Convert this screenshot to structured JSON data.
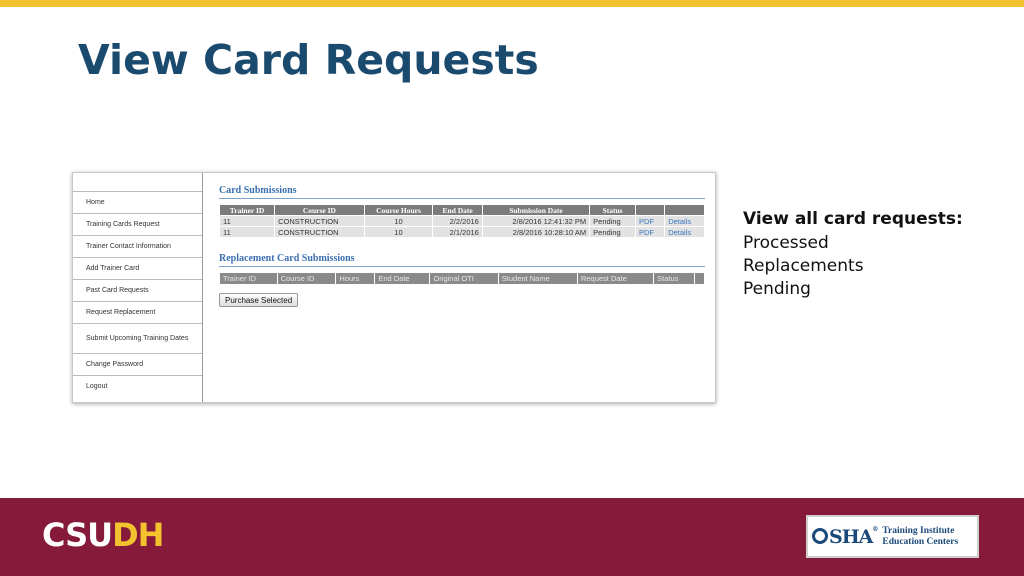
{
  "slide": {
    "title": "View Card Requests",
    "side_heading": "View all card requests:",
    "side_items": [
      "Processed",
      "Replacements",
      "Pending"
    ],
    "colors": {
      "title": "#1b4a6f",
      "top_bar": "#f3c22f",
      "footer": "#861a3a"
    }
  },
  "sidebar": {
    "items": [
      {
        "label": "Home"
      },
      {
        "label": "Training Cards Request"
      },
      {
        "label": "Trainer Contact Information"
      },
      {
        "label": "Add Trainer Card"
      },
      {
        "label": "Past Card Requests"
      },
      {
        "label": "Request Replacement"
      },
      {
        "label": "Submit Upcoming Training Dates"
      },
      {
        "label": "Change Password"
      },
      {
        "label": "Logout"
      }
    ]
  },
  "card_submissions": {
    "title": "Card Submissions",
    "headers": [
      "Trainer ID",
      "Course ID",
      "Course Hours",
      "End Date",
      "Submission Date",
      "Status",
      "",
      ""
    ],
    "rows": [
      [
        "11",
        "CONSTRUCTION",
        "10",
        "2/2/2016",
        "2/8/2016 12:41:32 PM",
        "Pending",
        "PDF",
        "Details"
      ],
      [
        "11",
        "CONSTRUCTION",
        "10",
        "2/1/2016",
        "2/8/2016 10:28:10 AM",
        "Pending",
        "PDF",
        "Details"
      ]
    ]
  },
  "replacement_submissions": {
    "title": "Replacement Card Submissions",
    "headers": [
      "Trainer ID",
      "Course ID",
      "Hours",
      "End Date",
      "Original OTI",
      "Student Name",
      "Request Date",
      "Status",
      ""
    ]
  },
  "purchase_button": "Purchase Selected",
  "footer": {
    "logo_left": "CSU",
    "logo_right": "DH",
    "osha_word": "SHA",
    "osha_mark": "®",
    "osha_line1": "Training Institute",
    "osha_line2": "Education Centers"
  }
}
